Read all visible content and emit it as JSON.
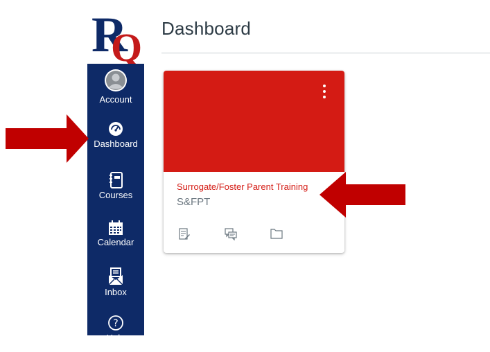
{
  "logo": {
    "text": "RQ",
    "colors": {
      "primary": "#0e2a67",
      "accent": "#c41a1a"
    }
  },
  "sidebar": {
    "background": "#0e2a67",
    "items": [
      {
        "label": "Account",
        "icon": "avatar-icon"
      },
      {
        "label": "Dashboard",
        "icon": "dashboard-gauge-icon"
      },
      {
        "label": "Courses",
        "icon": "courses-book-icon"
      },
      {
        "label": "Calendar",
        "icon": "calendar-icon"
      },
      {
        "label": "Inbox",
        "icon": "inbox-envelope-icon"
      },
      {
        "label": "Help",
        "icon": "help-icon"
      }
    ]
  },
  "main": {
    "title": "Dashboard",
    "course_card": {
      "name": "Surrogate/Foster Parent Training",
      "code": "S&FPT",
      "color": "#d41b14",
      "actions": [
        "assignments-icon",
        "discussions-icon",
        "files-icon"
      ]
    }
  },
  "annotations": {
    "arrow_color": "#c00000",
    "arrows": [
      "arrow-to-dashboard",
      "arrow-to-course"
    ]
  }
}
